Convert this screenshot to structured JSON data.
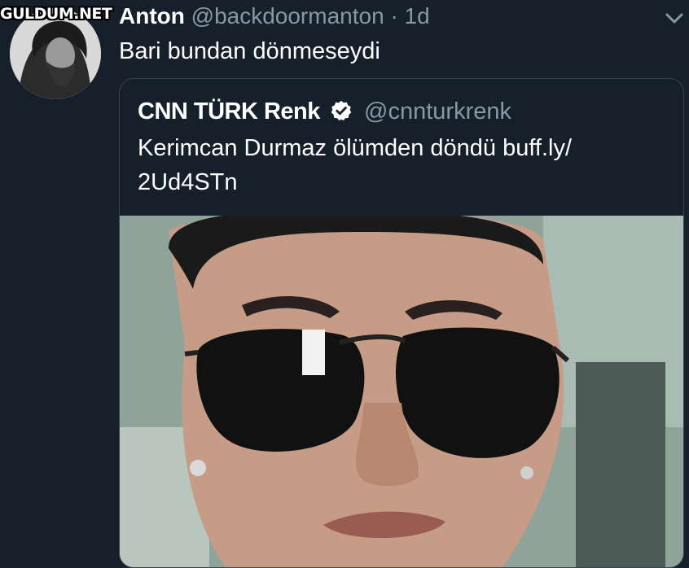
{
  "watermark": "GULDUM.NET",
  "tweet": {
    "author_name": "Anton",
    "author_handle": "@backdoormanton",
    "separator": "·",
    "time": "1d",
    "text": "Bari bundan dönmeseydi"
  },
  "quoted_tweet": {
    "author_name": "CNN TÜRK Renk",
    "verified_icon": "verified-badge-icon",
    "author_handle": "@cnnturkrenk",
    "text": "Kerimcan Durmaz ölümden döndü buff.ly/ 2Ud4STn"
  },
  "icons": {
    "menu": "chevron-down-icon",
    "avatar": "avatar-photo",
    "media": "quoted-photo"
  },
  "colors": {
    "background": "#15202b",
    "text_primary": "#ffffff",
    "text_secondary": "#8899a6",
    "border": "#38444d"
  }
}
